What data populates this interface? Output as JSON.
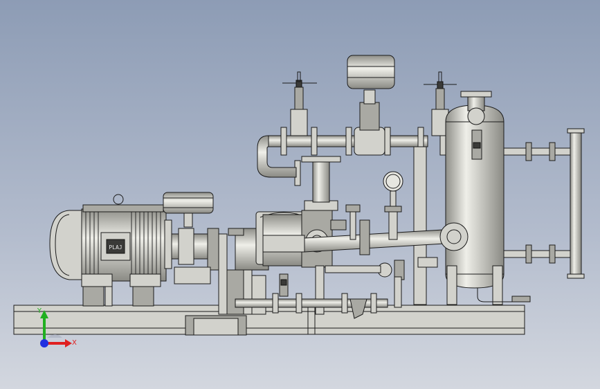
{
  "motor": {
    "nameplate": "PLAJ"
  },
  "triad": {
    "x_label": "X",
    "y_label": "Y",
    "x_color": "#e02020",
    "y_color": "#20b020",
    "origin_color": "#2030e0"
  },
  "colors": {
    "metal": "#d2d2cc",
    "metal_dark": "#a9a9a3",
    "background_top": "#8d9cb5",
    "background_bottom": "#d3d7df"
  }
}
